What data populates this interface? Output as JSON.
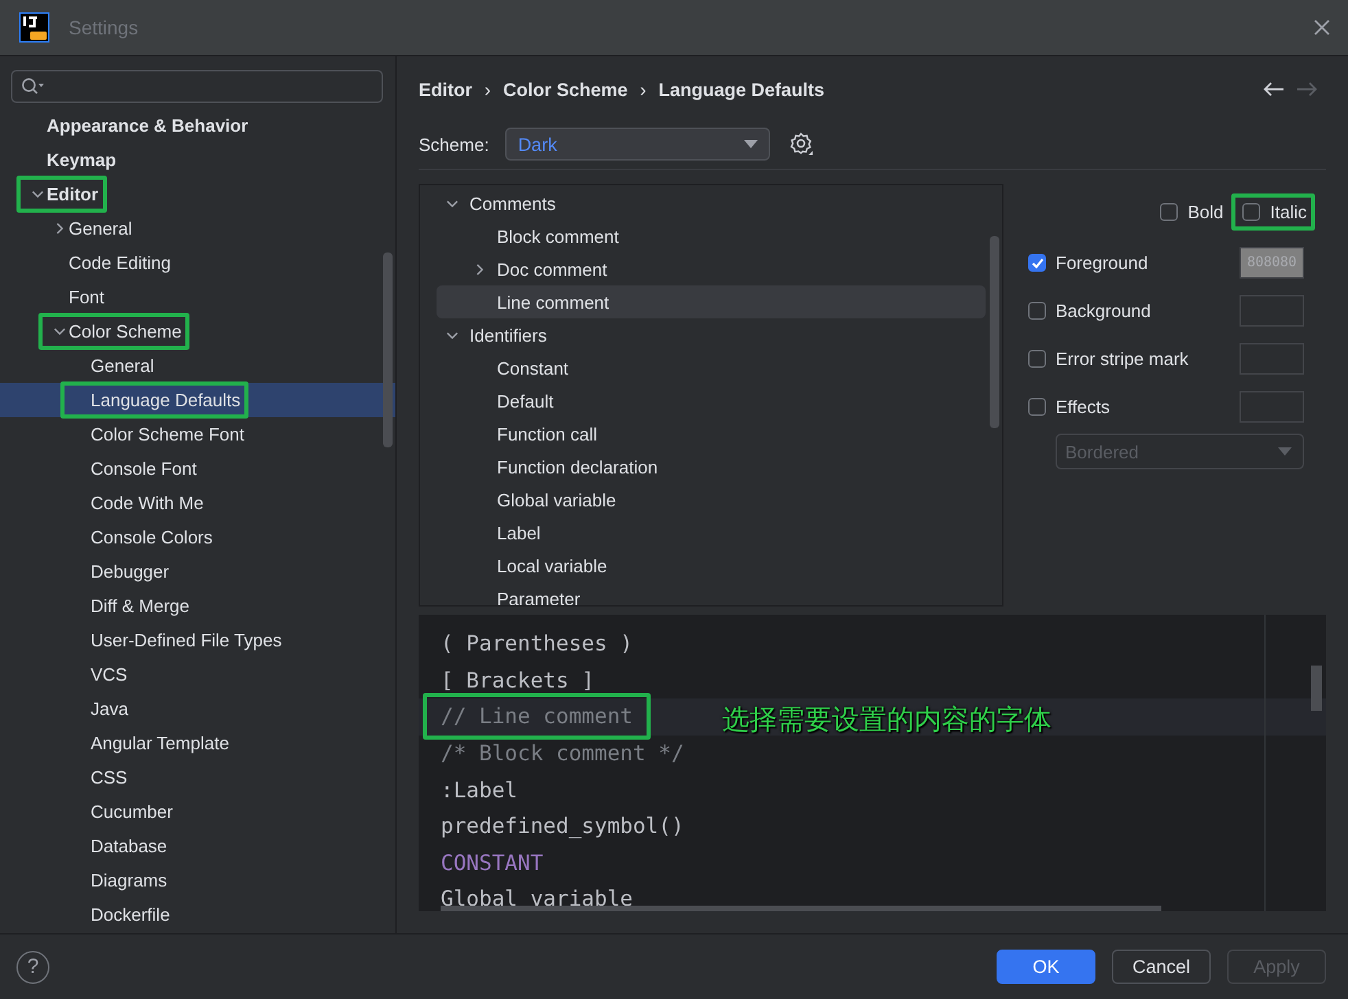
{
  "window": {
    "title": "Settings"
  },
  "sidebar": {
    "items": [
      {
        "label": "Appearance & Behavior",
        "selected": false,
        "annotated": false
      },
      {
        "label": "Keymap",
        "selected": false,
        "annotated": false
      },
      {
        "label": "Editor",
        "selected": false,
        "annotated": true,
        "expanded": true,
        "children": [
          {
            "label": "General",
            "selected": false,
            "annotated": false,
            "expanded": false
          },
          {
            "label": "Code Editing",
            "selected": false,
            "annotated": false
          },
          {
            "label": "Font",
            "selected": false,
            "annotated": false
          },
          {
            "label": "Color Scheme",
            "selected": false,
            "annotated": true,
            "expanded": true,
            "children": [
              {
                "label": "General",
                "selected": false,
                "annotated": false
              },
              {
                "label": "Language Defaults",
                "selected": true,
                "annotated": true
              },
              {
                "label": "Color Scheme Font",
                "selected": false,
                "annotated": false
              },
              {
                "label": "Console Font",
                "selected": false,
                "annotated": false
              },
              {
                "label": "Code With Me",
                "selected": false,
                "annotated": false
              },
              {
                "label": "Console Colors",
                "selected": false,
                "annotated": false
              },
              {
                "label": "Debugger",
                "selected": false,
                "annotated": false
              },
              {
                "label": "Diff & Merge",
                "selected": false,
                "annotated": false
              },
              {
                "label": "User-Defined File Types",
                "selected": false,
                "annotated": false
              },
              {
                "label": "VCS",
                "selected": false,
                "annotated": false
              },
              {
                "label": "Java",
                "selected": false,
                "annotated": false
              },
              {
                "label": "Angular Template",
                "selected": false,
                "annotated": false
              },
              {
                "label": "CSS",
                "selected": false,
                "annotated": false
              },
              {
                "label": "Cucumber",
                "selected": false,
                "annotated": false
              },
              {
                "label": "Database",
                "selected": false,
                "annotated": false
              },
              {
                "label": "Diagrams",
                "selected": false,
                "annotated": false
              },
              {
                "label": "Dockerfile",
                "selected": false,
                "annotated": false
              }
            ]
          }
        ]
      }
    ]
  },
  "breadcrumb": [
    "Editor",
    "Color Scheme",
    "Language Defaults"
  ],
  "breadcrumb_separators": [
    "›",
    "›"
  ],
  "nav": {
    "back_enabled": true,
    "forward_enabled": false
  },
  "scheme": {
    "label": "Scheme:",
    "value": "Dark"
  },
  "attributes": [
    {
      "label": "Comments",
      "selected": false,
      "expanded": true,
      "children": [
        {
          "label": "Block comment",
          "selected": false
        },
        {
          "label": "Doc comment",
          "selected": false,
          "expanded": false
        },
        {
          "label": "Line comment",
          "selected": true
        }
      ]
    },
    {
      "label": "Identifiers",
      "selected": false,
      "expanded": true,
      "children": [
        {
          "label": "Constant",
          "selected": false
        },
        {
          "label": "Default",
          "selected": false
        },
        {
          "label": "Function call",
          "selected": false
        },
        {
          "label": "Function declaration",
          "selected": false
        },
        {
          "label": "Global variable",
          "selected": false
        },
        {
          "label": "Label",
          "selected": false
        },
        {
          "label": "Local variable",
          "selected": false
        },
        {
          "label": "Parameter",
          "selected": false
        }
      ]
    }
  ],
  "font_style": [
    {
      "label": "Bold",
      "checked": false,
      "annotated": false
    },
    {
      "label": "Italic",
      "checked": false,
      "annotated": true
    }
  ],
  "options": [
    {
      "label": "Foreground",
      "checked": true,
      "swatch": "808080",
      "color": "#808080"
    },
    {
      "label": "Background",
      "checked": false
    },
    {
      "label": "Error stripe mark",
      "checked": false
    },
    {
      "label": "Effects",
      "checked": false
    }
  ],
  "effect_type": {
    "value": "Bordered",
    "disabled": true
  },
  "preview": {
    "lines": [
      {
        "text": "( Parentheses )",
        "color": "#bcbec4",
        "current": false,
        "annotated": false
      },
      {
        "text": "[ Brackets ]",
        "color": "#bcbec4",
        "current": false,
        "annotated": false
      },
      {
        "text": "// Line comment",
        "color": "#7a7e85",
        "current": true,
        "annotated": true
      },
      {
        "text": "/* Block comment */",
        "color": "#7a7e85",
        "current": false,
        "annotated": false
      },
      {
        "text": ":Label",
        "color": "#bcbec4",
        "current": false,
        "annotated": false
      },
      {
        "text": "predefined_symbol()",
        "color": "#bcbec4",
        "current": false,
        "annotated": false
      },
      {
        "text": "CONSTANT",
        "color": "#9876c0",
        "current": false,
        "annotated": false
      },
      {
        "text": "Global variable",
        "color": "#bcbec4",
        "current": false,
        "annotated": false
      }
    ],
    "annotation": "选择需要设置的内容的字体"
  },
  "buttons": [
    {
      "label": "OK",
      "kind": "primary"
    },
    {
      "label": "Cancel",
      "kind": "normal"
    },
    {
      "label": "Apply",
      "kind": "disabled"
    }
  ],
  "help": "?"
}
